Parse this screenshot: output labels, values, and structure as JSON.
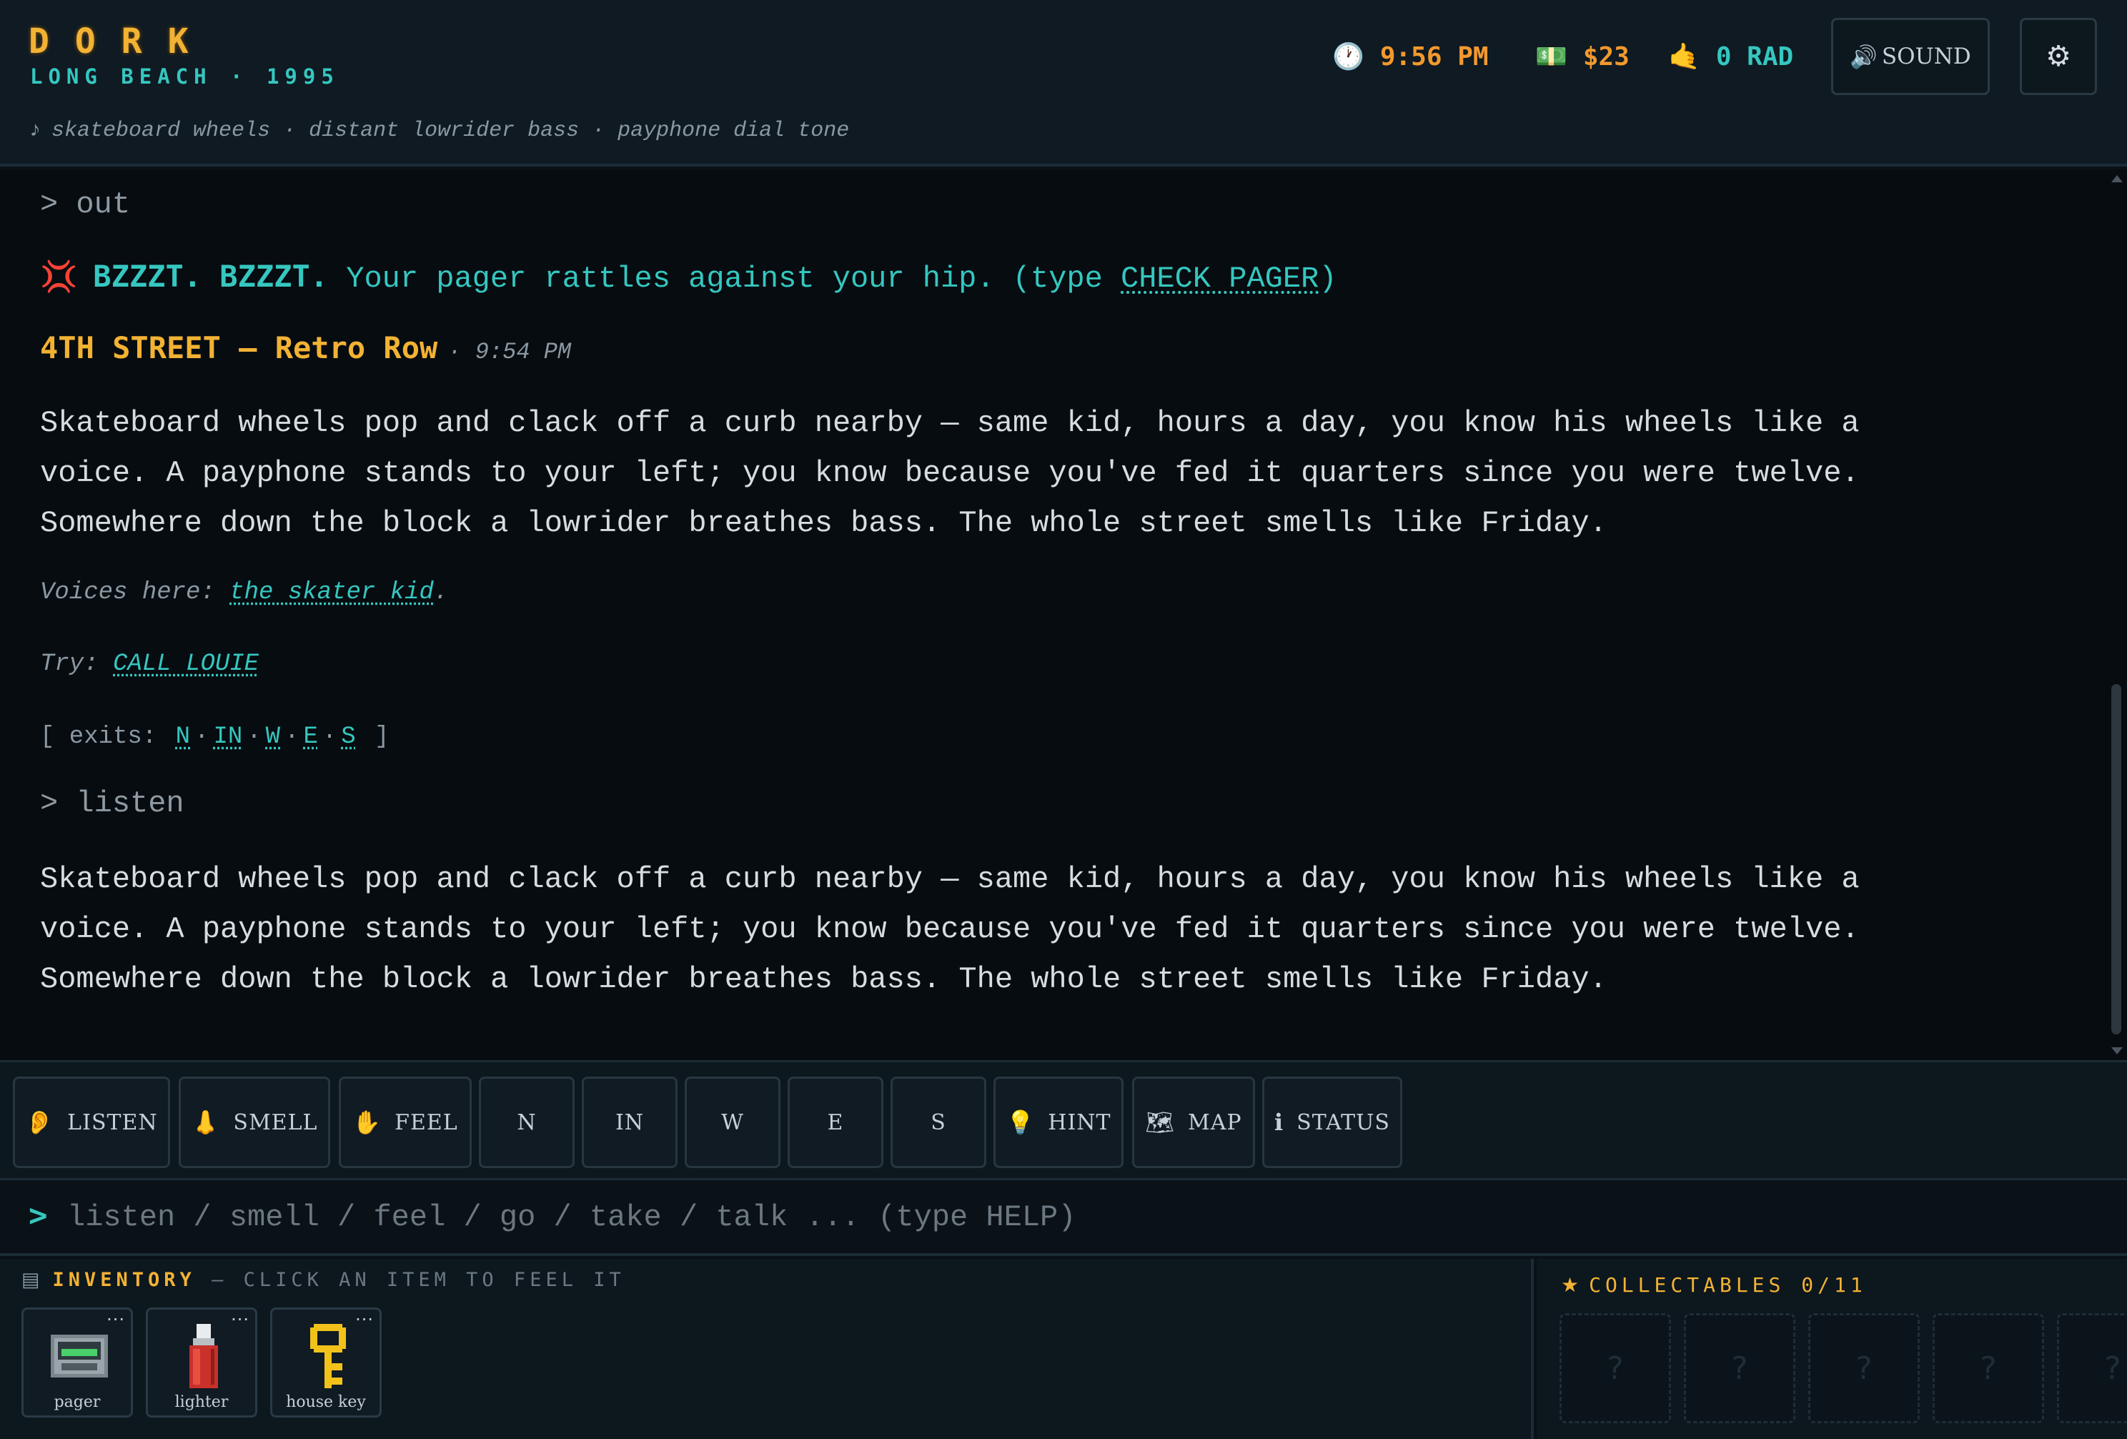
{
  "header": {
    "title": "DORK",
    "subtitle": "LONG BEACH · 1995",
    "ambience_note": "♪",
    "ambience": "skateboard wheels · distant lowrider bass · payphone dial tone",
    "time_icon": "🕐",
    "time": "9:56 PM",
    "money_icon": "💵",
    "money": "$23",
    "rad_icon": "🤙",
    "rad": "0 RAD",
    "sound_icon": "🔊",
    "sound_label": "SOUND",
    "settings_icon": "⚙"
  },
  "log": {
    "cmd1": "> out",
    "pager_icon": "💢",
    "pager_buzz": "BZZZT. BZZZT.",
    "pager_text": " Your pager rattles against your hip. (type ",
    "pager_link": "CHECK PAGER",
    "pager_close": ")",
    "location_name": "4TH STREET — Retro Row",
    "location_time": "· 9:54 PM",
    "description": [
      "Skateboard wheels pop and clack off a curb nearby — same kid, hours a day, you know his wheels like a",
      "voice. A payphone stands to your left; you know because you've fed it quarters since you were twelve.",
      "Somewhere down the block a lowrider breathes bass. The whole street smells like Friday."
    ],
    "voices_label": "Voices here: ",
    "voices_link": "the skater kid",
    "voices_end": ".",
    "try_label": "Try: ",
    "try_link": "CALL LOUIE",
    "exits_open": "[ exits: ",
    "exits": [
      "N",
      "IN",
      "W",
      "E",
      "S"
    ],
    "exits_sep": "·",
    "exits_close": " ]",
    "cmd2": "> listen",
    "description2": [
      "Skateboard wheels pop and clack off a curb nearby — same kid, hours a day, you know his wheels like a",
      "voice. A payphone stands to your left; you know because you've fed it quarters since you were twelve.",
      "Somewhere down the block a lowrider breathes bass. The whole street smells like Friday."
    ]
  },
  "actions": [
    {
      "icon": "👂",
      "label": "LISTEN"
    },
    {
      "icon": "👃",
      "label": "SMELL"
    },
    {
      "icon": "✋",
      "label": "FEEL"
    },
    {
      "icon": "",
      "label": "N"
    },
    {
      "icon": "",
      "label": "IN"
    },
    {
      "icon": "",
      "label": "W"
    },
    {
      "icon": "",
      "label": "E"
    },
    {
      "icon": "",
      "label": "S"
    },
    {
      "icon": "💡",
      "label": "HINT"
    },
    {
      "icon": "🗺",
      "label": "MAP"
    },
    {
      "icon": "ℹ",
      "label": "STATUS"
    }
  ],
  "input": {
    "prompt": ">",
    "placeholder": "listen / smell / feel / go / take / talk ... (type HELP)"
  },
  "inventory": {
    "icon": "▤",
    "title": "INVENTORY",
    "subtitle": " — CLICK AN ITEM TO FEEL IT",
    "dots": "···",
    "items": [
      {
        "label": "pager",
        "icon": "pager-icon"
      },
      {
        "label": "lighter",
        "icon": "lighter-icon"
      },
      {
        "label": "house key",
        "icon": "key-icon"
      }
    ]
  },
  "collectables": {
    "icon": "★",
    "title": "COLLECTABLES 0/11",
    "slot_mark": "?"
  },
  "colors": {
    "gold": "#f2b233",
    "orange": "#f2992e",
    "teal": "#35c7c0",
    "alarm": "#e23b3b"
  }
}
